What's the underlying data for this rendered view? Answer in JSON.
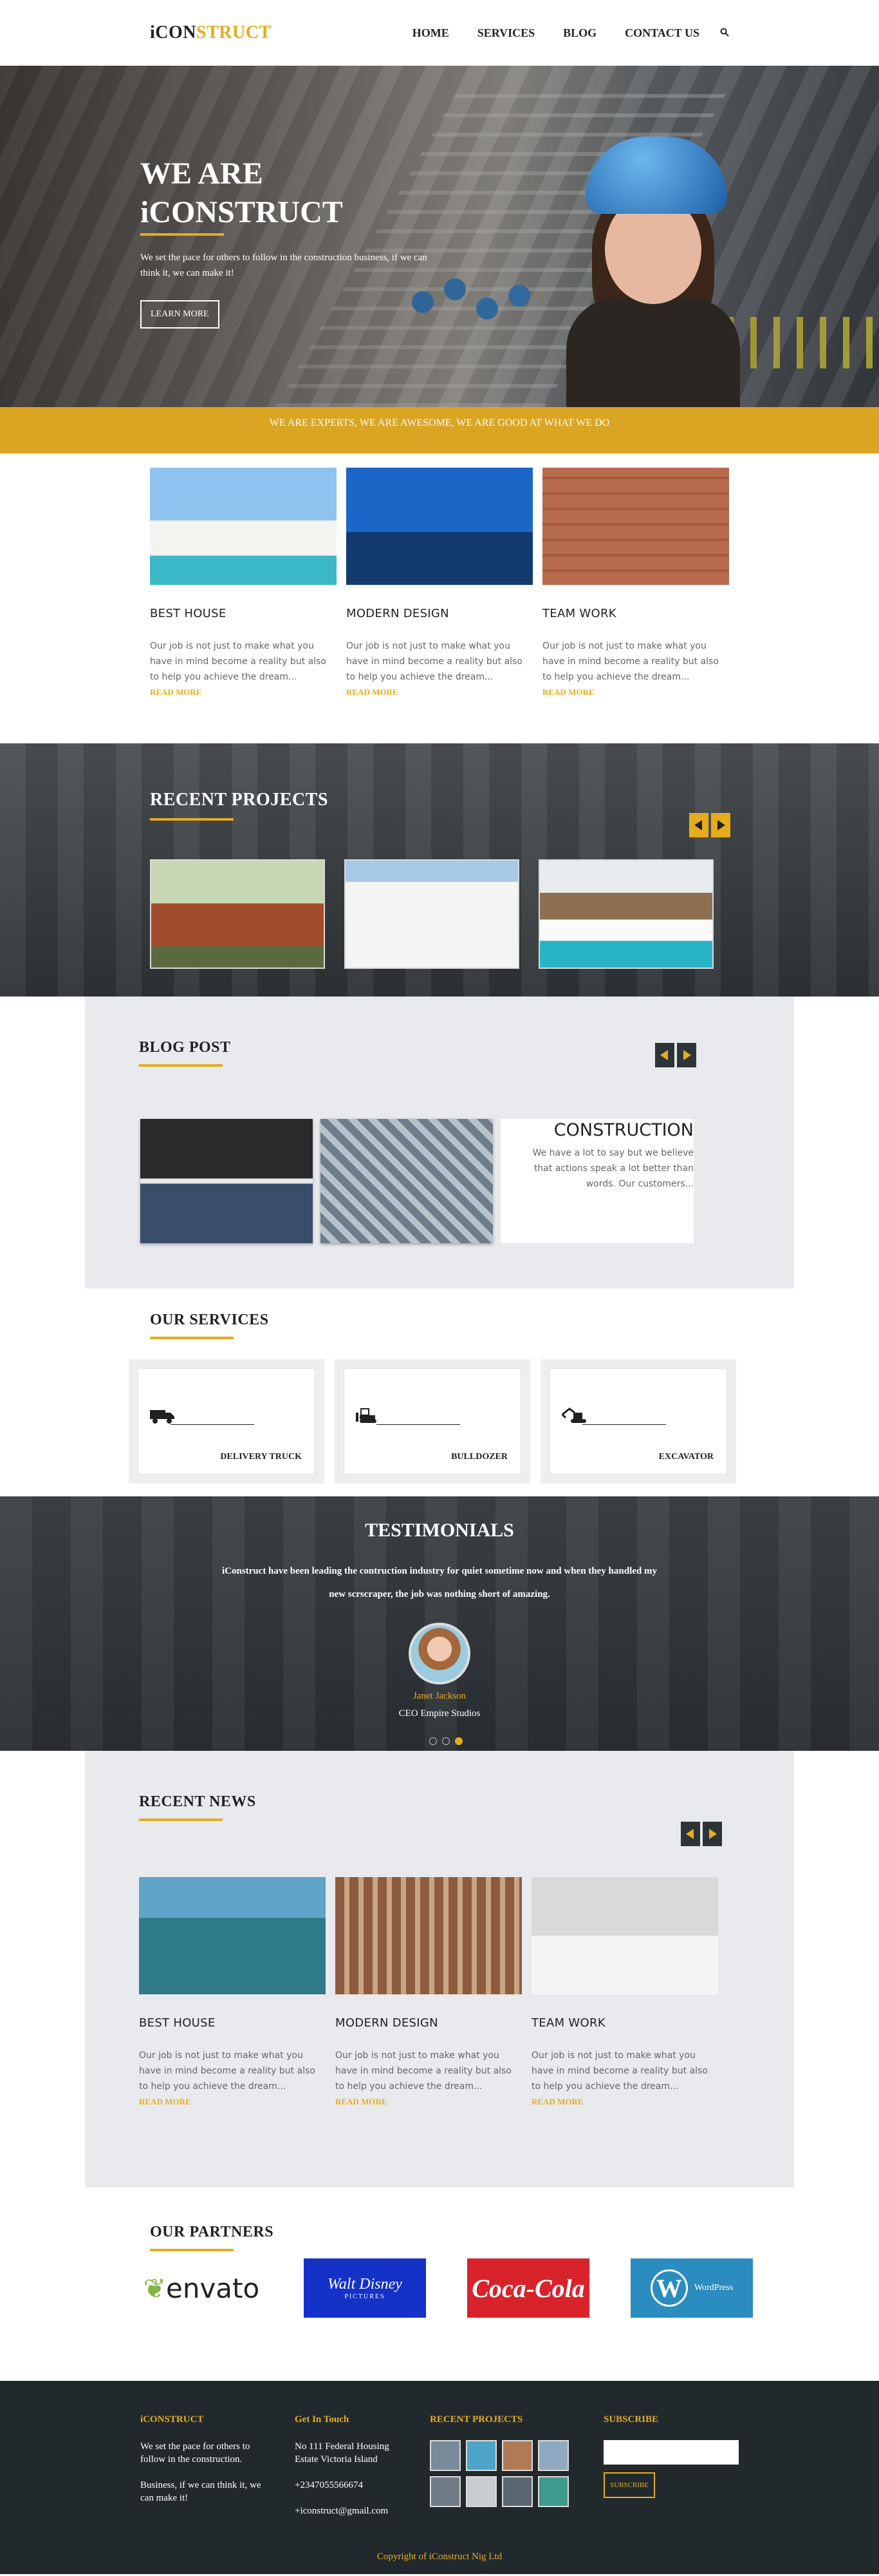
{
  "header": {
    "logo_a": "iCON",
    "logo_b": "STRUCT",
    "nav": [
      "HOME",
      "SERVICES",
      "BLOG",
      "CONTACT US"
    ],
    "search_icon": "search-icon"
  },
  "hero": {
    "line1": "WE ARE",
    "line2": "iCONSTRUCT",
    "text": "We set the pace for others to follow in the construction business, if we can think it, we can make it!",
    "button": "LEARN MORE"
  },
  "banner": "WE ARE EXPERTS, WE ARE AWESOME, WE ARE GOOD AT WHAT WE DO",
  "features": [
    {
      "title": "BEST HOUSE",
      "text": "Our job is not just to make what you have in mind become a reality but also to help you achieve the dream...",
      "more": "READ MORE"
    },
    {
      "title": "MODERN DESIGN",
      "text": "Our job is not just to make what you have in mind become a reality but also to help you achieve the dream...",
      "more": "READ MORE"
    },
    {
      "title": "TEAM WORK",
      "text": "Our job is not just to make what you have in mind become a reality but also to help you achieve the dream...",
      "more": "READ MORE"
    }
  ],
  "projects": {
    "title": "RECENT PROJECTS"
  },
  "blog": {
    "title": "BLOG POST",
    "card_title": "CONSTRUCTION",
    "card_text": "We have a lot to say but we believe that actions speak a lot better than words. Our customers..."
  },
  "services": {
    "title": "OUR SERVICES",
    "items": [
      {
        "label": "DELIVERY TRUCK",
        "icon": "truck-icon"
      },
      {
        "label": "BULLDOZER",
        "icon": "bulldozer-icon"
      },
      {
        "label": "EXCAVATOR",
        "icon": "excavator-icon"
      }
    ]
  },
  "testimonials": {
    "title": "TESTIMONIALS",
    "quote": "iConstruct have been leading the contruction industry for quiet sometime now and when they handled my new scrscraper, the job was nothing short of amazing.",
    "name": "Janet Jackson",
    "role": "CEO Empire Studios"
  },
  "news": {
    "title": "RECENT NEWS",
    "items": [
      {
        "title": "BEST HOUSE",
        "text": "Our job is not just to make what you have in mind become a reality but also to help you achieve the dream...",
        "more": "READ MORE"
      },
      {
        "title": "MODERN DESIGN",
        "text": "Our job is not just to make what you have in mind become a reality but also to help you achieve the dream...",
        "more": "READ MORE"
      },
      {
        "title": "TEAM WORK",
        "text": "Our job is not just to make what you have in mind become a reality but also to help you achieve the dream...",
        "more": "READ MORE"
      }
    ]
  },
  "partners": {
    "title": "OUR PARTNERS",
    "envato": "envato",
    "disney": "Walt Disney",
    "disney_sub": "PICTURES",
    "coke": "Coca-Cola",
    "wp_letter": "W",
    "wp": "WordPress"
  },
  "footer": {
    "col1_title": "iCONSTRUCT",
    "col1_p1": "We set the pace for others to follow in the construction.",
    "col1_p2": "Business, if we can think it, we can make it!",
    "col2_title": "Get In Touch",
    "address": "No 111 Federal Housing Estate Victoria Island",
    "phone": "+2347055566674",
    "email": "+iconstruct@gmail.com",
    "col3_title": "RECENT PROJECTS",
    "col4_title": "SUBSCRIBE",
    "subscribe_button": "SUBSCRIBE",
    "copyright": "Copyright of iConstruct Nig Ltd"
  },
  "colors": {
    "accent": "#e6ac1e",
    "footer_bg": "#22292d",
    "section_gray": "#e8eaed"
  }
}
